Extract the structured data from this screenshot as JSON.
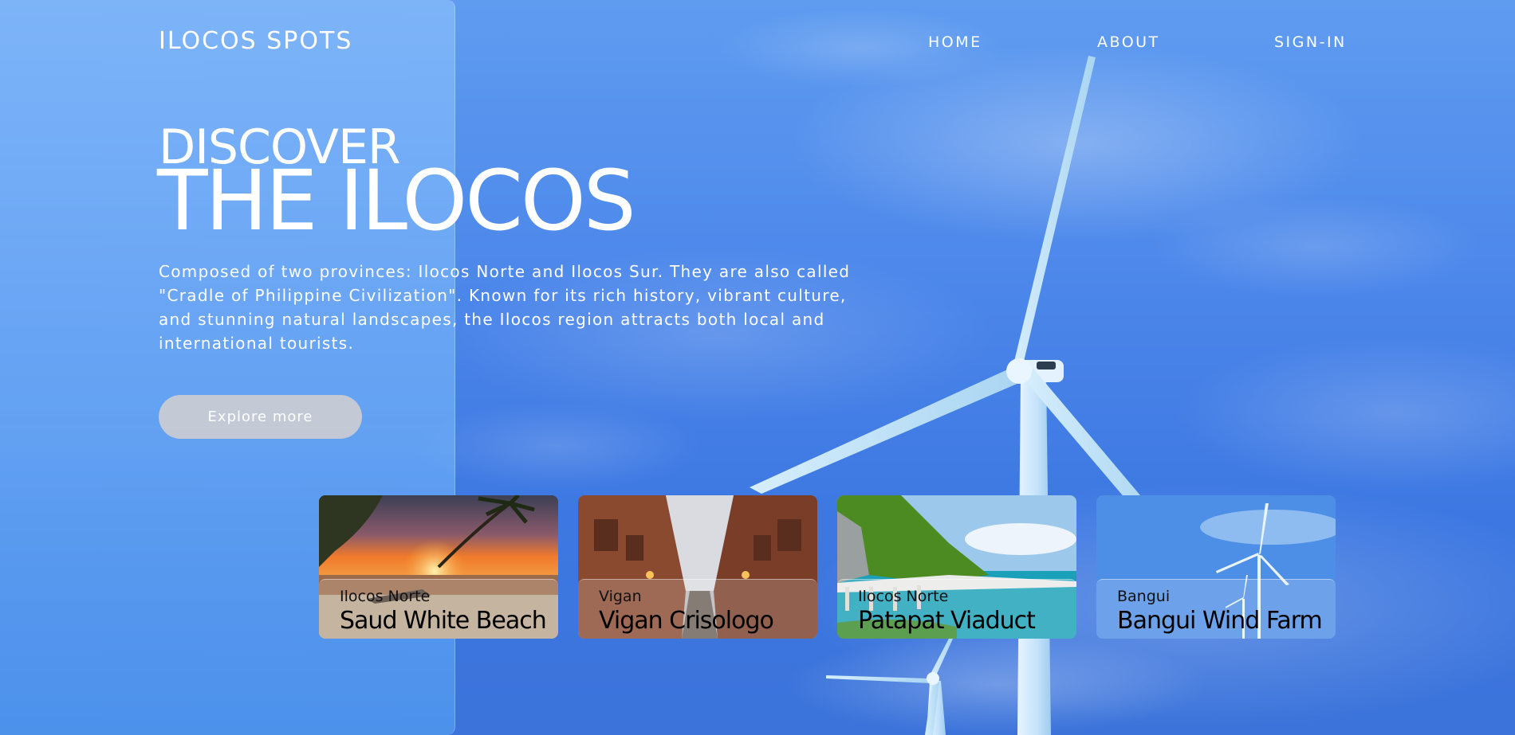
{
  "header": {
    "brand": "ILOCOS SPOTS",
    "nav": {
      "home": "HOME",
      "about": "ABOUT",
      "signin": "SIGN-IN"
    }
  },
  "hero": {
    "discover": "DISCOVER",
    "title": "THE ILOCOS",
    "description": "Composed of two provinces: Ilocos Norte and Ilocos Sur. They are also called \"Cradle of Philippine Civilization\". Known for its rich history, vibrant culture, and stunning natural landscapes, the Ilocos region attracts both local and international tourists.",
    "cta": "Explore more"
  },
  "cards": [
    {
      "location": "Ilocos Norte",
      "name": "Saud White Beach"
    },
    {
      "location": "Vigan",
      "name": "Vigan Crisologo"
    },
    {
      "location": "Ilocos Norte",
      "name": "Patapat Viaduct"
    },
    {
      "location": "Bangui",
      "name": "Bangui Wind Farm"
    }
  ],
  "colors": {
    "sky": "#4b86ea",
    "glass": "#8fc6ff",
    "button": "#cdcdd2",
    "text": "#ffffff"
  }
}
